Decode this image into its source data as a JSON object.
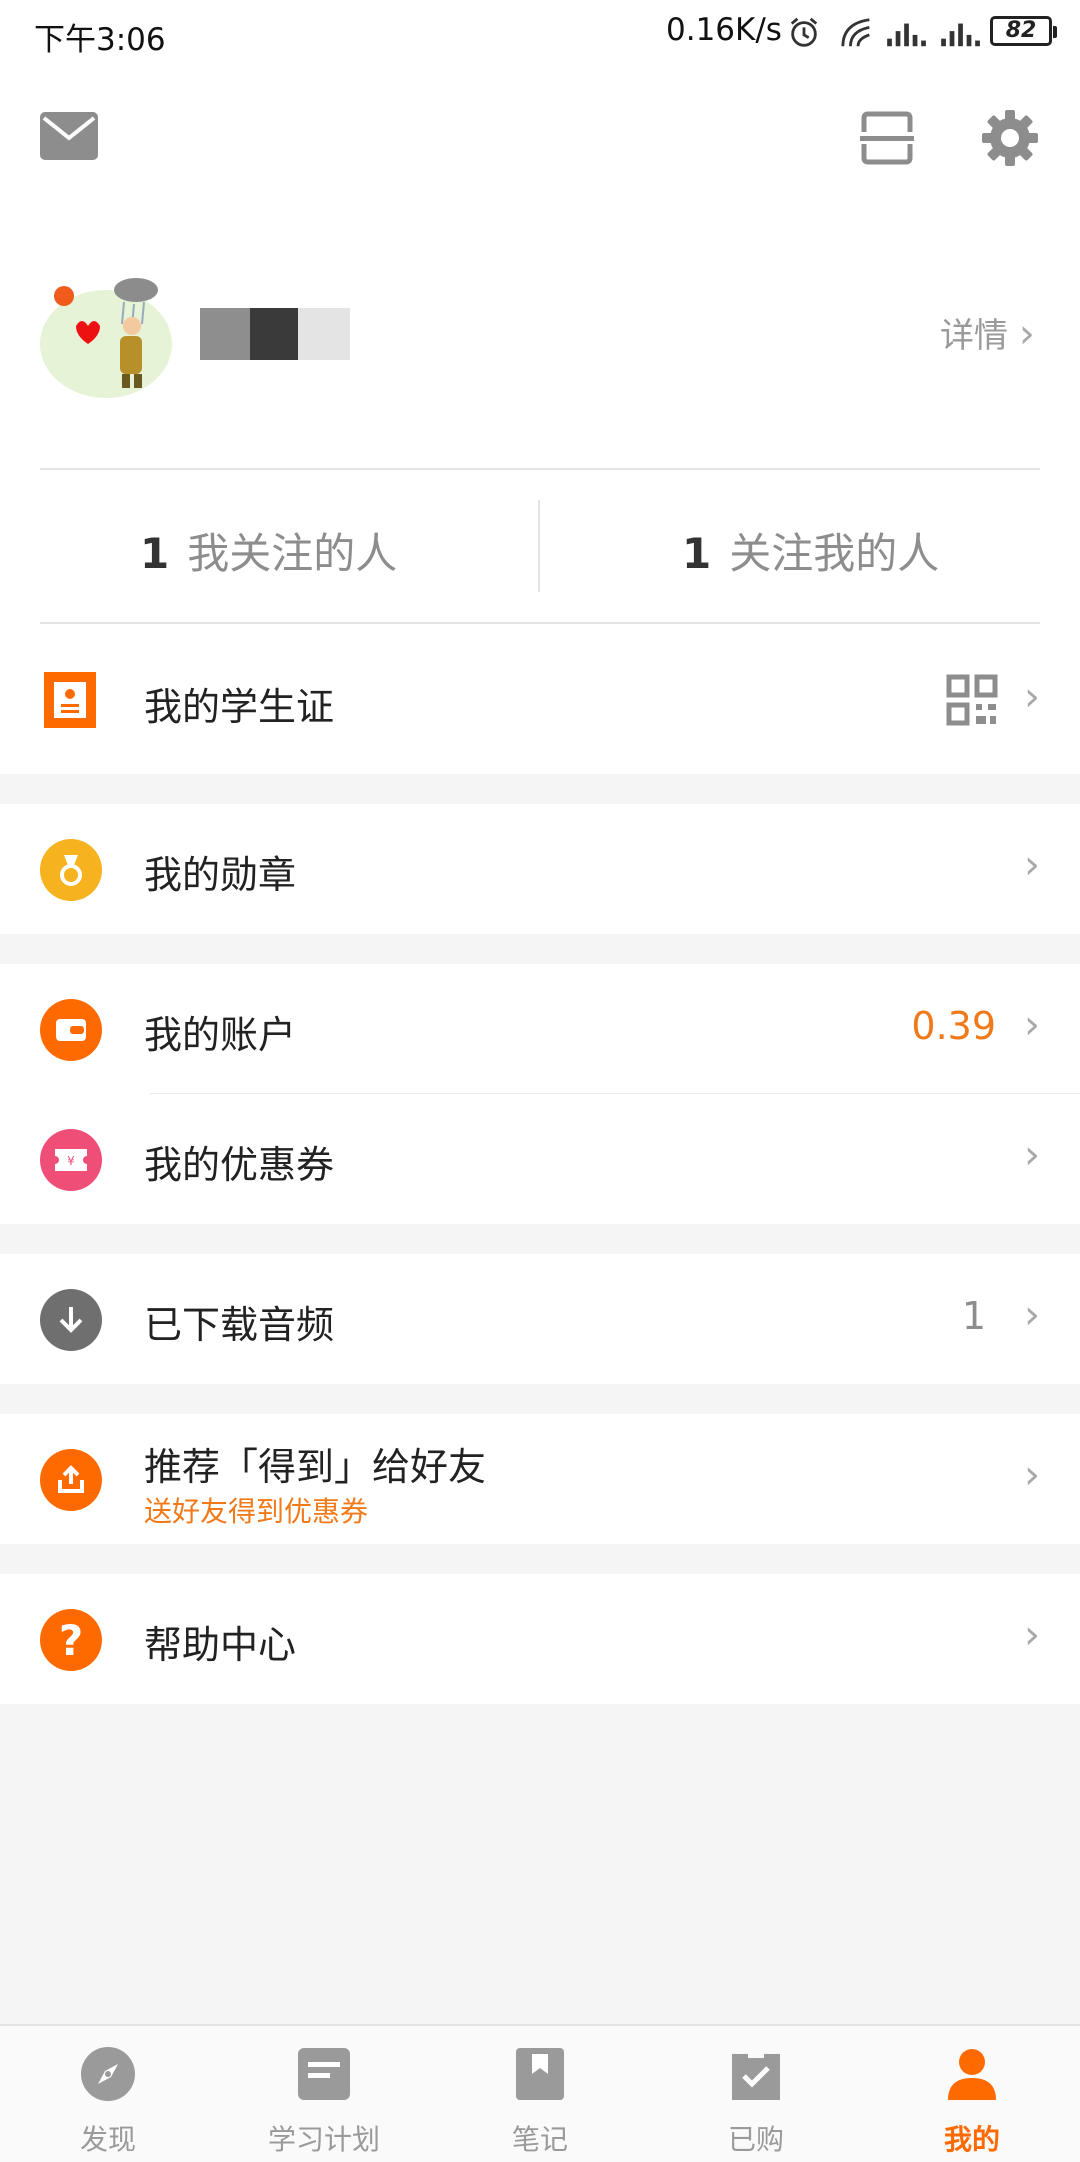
{
  "status_bar": {
    "time": "下午3:06",
    "speed": "0.16K/s",
    "battery": "82"
  },
  "header": {
    "detail_label": "详情"
  },
  "follow": {
    "following_count": "1",
    "following_label": "我关注的人",
    "followers_count": "1",
    "followers_label": "关注我的人"
  },
  "menu": {
    "student_card": "我的学生证",
    "medals": "我的勋章",
    "account": "我的账户",
    "account_value": "0.39",
    "coupons": "我的优惠券",
    "downloads": "已下载音频",
    "downloads_value": "1",
    "recommend": "推荐「得到」给好友",
    "recommend_sub": "送好友得到优惠券",
    "help": "帮助中心"
  },
  "nav": [
    {
      "label": "发现",
      "icon": "compass-icon"
    },
    {
      "label": "学习计划",
      "icon": "plan-icon"
    },
    {
      "label": "笔记",
      "icon": "bookmark-icon"
    },
    {
      "label": "已购",
      "icon": "purchased-icon"
    },
    {
      "label": "我的",
      "icon": "person-icon"
    }
  ],
  "colors": {
    "accent": "#ff6a00",
    "orange_value": "#f07a1a",
    "medal_yellow": "#f6b21f",
    "coupon_pink": "#ef4f76",
    "download_gray": "#6f6f6f"
  }
}
